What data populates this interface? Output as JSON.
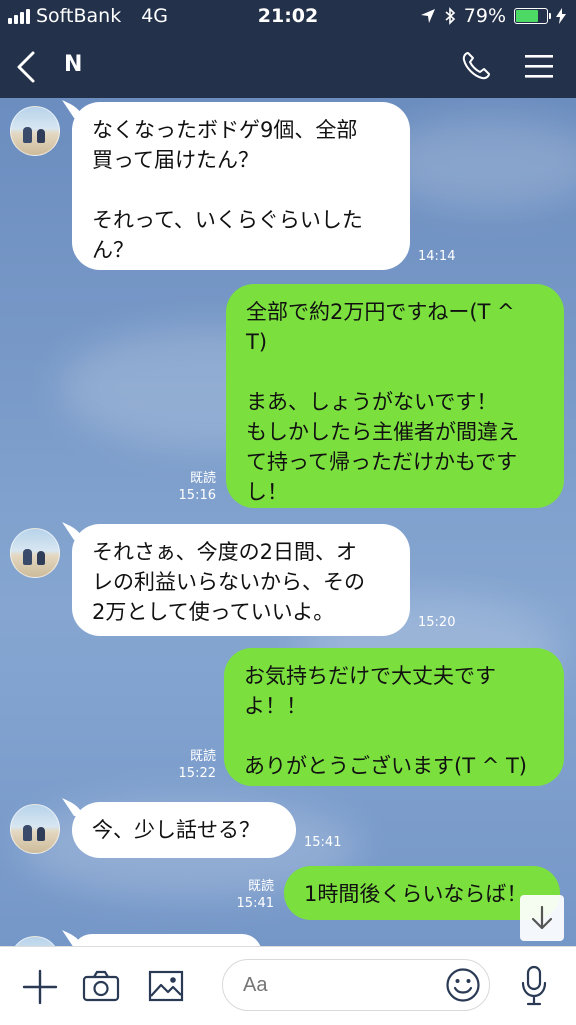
{
  "status_bar": {
    "carrier": "SoftBank",
    "network": "4G",
    "time": "21:02",
    "battery": "79%",
    "battery_level": 0.79
  },
  "header": {
    "title": "N"
  },
  "messages": [
    {
      "side": "in",
      "text": "なくなったボドゲ9個、全部\n買って届けたん？\n\nそれって、いくらぐらいした\nん？",
      "time": "14:14"
    },
    {
      "side": "out",
      "text": "全部で約2万円ですねー(T ^\nT)\n\nまあ、しょうがないです！\nもしかしたら主催者が間違え\nて持って帰っただけかもです\nし！",
      "read": "既読",
      "time": "15:16"
    },
    {
      "side": "in",
      "text": "それさぁ、今度の2日間、オ\nレの利益いらないから、その\n2万として使っていいよ。",
      "time": "15:20"
    },
    {
      "side": "out",
      "text": "お気持ちだけで大丈夫です\nよ！！\n\nありがとうございます(T ^ T)",
      "read": "既読",
      "time": "15:22"
    },
    {
      "side": "in",
      "text": "今、少し話せる？",
      "time": "15:41"
    },
    {
      "side": "out",
      "text": "1時間後くらいならば！",
      "read": "既読",
      "time": "15:41"
    }
  ],
  "input": {
    "placeholder": "Aa"
  },
  "icons": {
    "back": "chevron-left-icon",
    "phone": "phone-icon",
    "menu": "hamburger-menu-icon",
    "add": "plus-icon",
    "camera": "camera-icon",
    "image": "image-icon",
    "emoji": "smiley-icon",
    "mic": "microphone-icon",
    "scroll": "arrow-down-icon"
  },
  "colors": {
    "header": "#23314a",
    "outgoing_bubble": "#7be03e",
    "incoming_bubble": "#ffffff"
  }
}
